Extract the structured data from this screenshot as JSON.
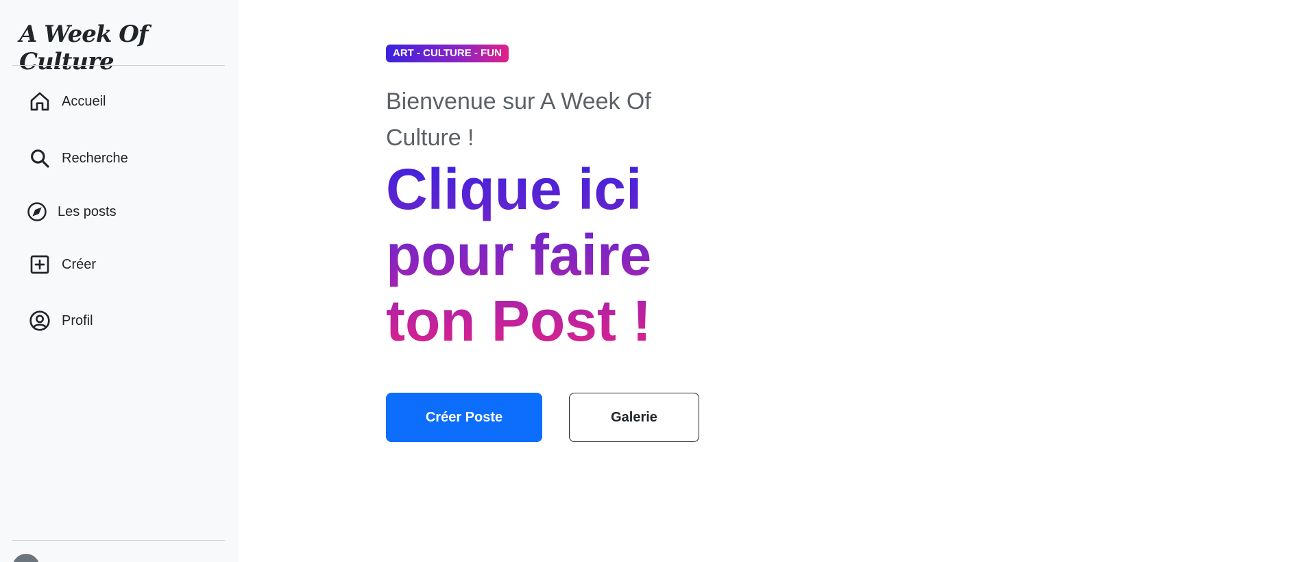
{
  "sidebar": {
    "brand": "A Week Of Culture",
    "items": [
      {
        "label": "Accueil",
        "icon": "home-icon"
      },
      {
        "label": "Recherche",
        "icon": "search-icon"
      },
      {
        "label": "Les posts",
        "icon": "compass-icon"
      },
      {
        "label": "Créer",
        "icon": "plus-square-icon"
      },
      {
        "label": "Profil",
        "icon": "user-circle-icon"
      }
    ]
  },
  "main": {
    "badge": "ART - CULTURE - FUN",
    "welcome": "Bienvenue sur A Week Of Culture !",
    "headline": "Clique ici pour faire ton Post !",
    "buttons": {
      "primary": "Créer Poste",
      "secondary": "Galerie"
    }
  },
  "colors": {
    "sidebar_bg": "#f8f9fa",
    "primary": "#0d6efd",
    "gradient_start": "#3b22de",
    "gradient_end": "#e0218a"
  }
}
